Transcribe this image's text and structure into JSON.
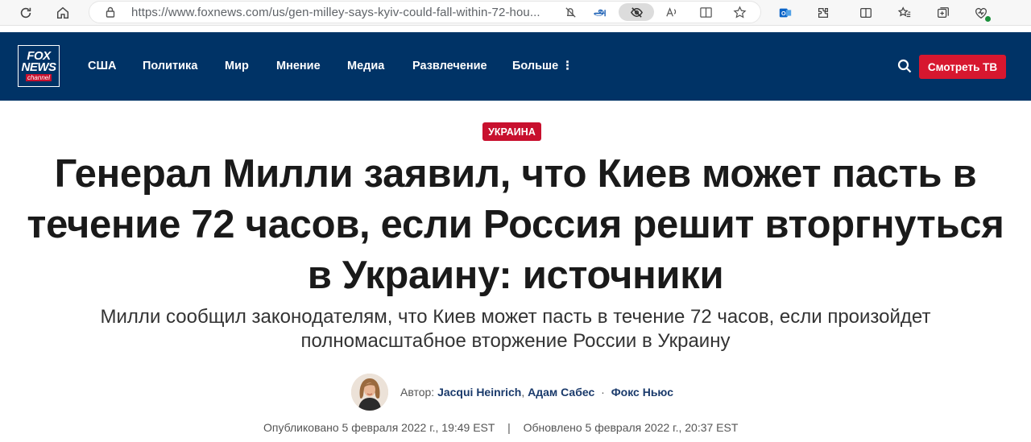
{
  "browser": {
    "url": "https://www.foxnews.com/us/gen-milley-says-kyiv-could-fall-within-72-hou..."
  },
  "site": {
    "logo_text_line1": "FOX",
    "logo_text_line2": "NEWS",
    "logo_text_line3": "channel",
    "nav_items": [
      "США",
      "Политика",
      "Мир",
      "Мнение",
      "Медиа",
      "Развлечение",
      "Больше ⋮"
    ],
    "watch_label": "Смотреть ТВ"
  },
  "article": {
    "tag": "УКРАИНА",
    "headline": "Генерал Милли заявил, что Киев может пасть в течение 72 часов, если Россия решит вторгнуться в Украину: источники",
    "subhead": "Милли сообщил законодателям, что Киев может пасть в течение 72 часов, если произойдет полномасштабное вторжение России в Украину",
    "byline_prefix": "Автор:",
    "author1": "Jacqui Heinrich",
    "comma": ",",
    "author2": "Адам Сабес",
    "bullet": "·",
    "outlet": "Фокс Ньюс",
    "published": "Опубликовано 5 февраля 2022 г., 19:49 EST",
    "divider": "|",
    "updated": "Обновлено 5 февраля 2022 г., 20:37 EST"
  },
  "colors": {
    "nav_bg": "#003366",
    "accent_red": "#c8102e",
    "author_blue": "#1a3a6b"
  }
}
